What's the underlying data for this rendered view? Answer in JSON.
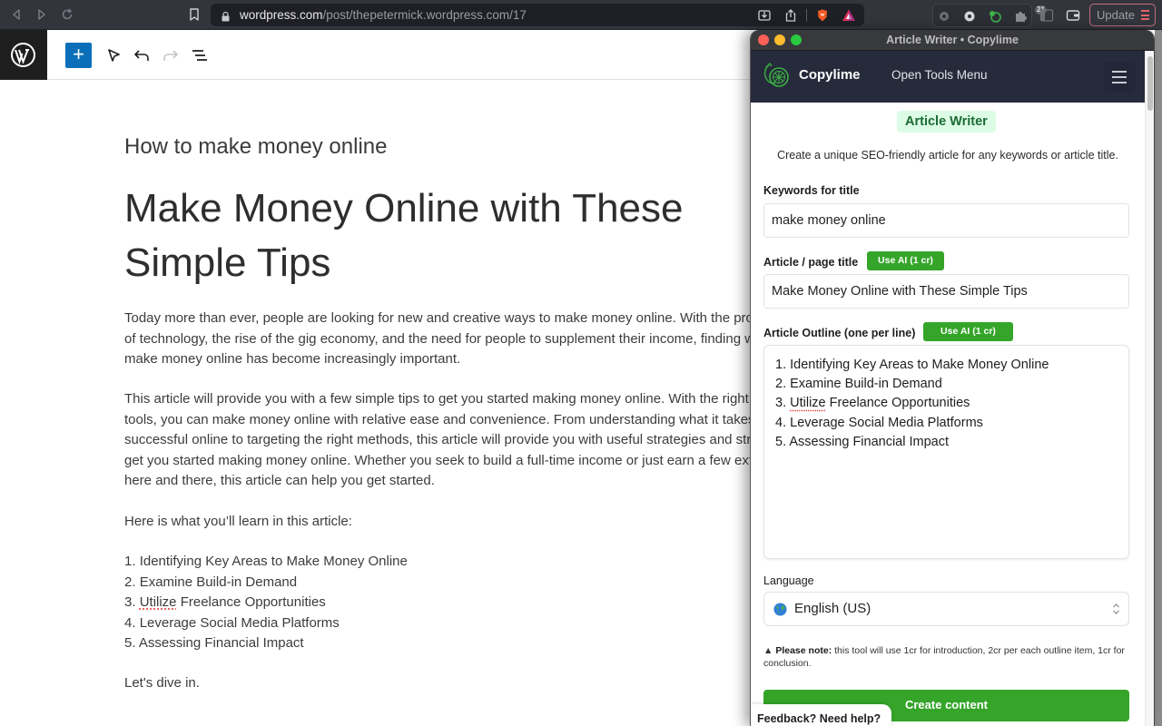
{
  "browser": {
    "url_host": "wordpress.com",
    "url_path": "/post/thepetermick.wordpress.com/17",
    "brave_shield_count": "21",
    "update_label": "Update",
    "icons": [
      "back-icon",
      "forward-icon",
      "reload-icon",
      "bookmark-icon",
      "lock-icon",
      "install-icon",
      "share-icon",
      "brave-shields-icon",
      "brave-rewards-icon",
      "extension-gear-icon",
      "extension-settings-icon",
      "copylime-extension-icon",
      "extensions-puzzle-icon",
      "sidebar-icon",
      "wallet-icon",
      "menu-icon"
    ]
  },
  "wordpress": {
    "toolbar": {
      "add_block_label": "+",
      "icons": [
        "wordpress-logo-icon",
        "add-block-icon",
        "select-tool-icon",
        "undo-icon",
        "redo-icon",
        "document-overview-icon"
      ]
    },
    "post": {
      "keyword_line": "How to make money online",
      "title": "Make Money Online with These Simple Tips",
      "paragraphs": [
        "Today more than ever, people are looking for new and creative ways to make money online. With the proliferation of technology, the rise of the gig economy, and the need for people to supplement their income, finding ways to make money online has become increasingly important.",
        "This article will provide you with a few simple tips to get you started making money online. With the right skills and tools, you can make money online with relative ease and convenience. From understanding what it takes to be successful online to targeting the right methods, this article will provide you with useful strategies and strategies to get you started making money online. Whether you seek to build a full-time income or just earn a few extra bucks here and there, this article can help you get started.",
        "Here is what you’ll learn in this article:"
      ],
      "outline": [
        {
          "num": "1. ",
          "text": "Identifying Key Areas to Make Money Online"
        },
        {
          "num": "2. ",
          "text": "Examine Build-in Demand"
        },
        {
          "num": "3. ",
          "spell": "Utilize",
          "text": " Freelance Opportunities"
        },
        {
          "num": "4. ",
          "text": "Leverage Social Media Platforms"
        },
        {
          "num": "5. ",
          "text": "Assessing Financial Impact"
        }
      ],
      "closing": "Let's dive in."
    }
  },
  "popup": {
    "window_title": "Article Writer • Copylime",
    "brand": "Copylime",
    "open_tools_menu": "Open Tools Menu",
    "tool_badge": "Article Writer",
    "subtitle": "Create a unique SEO-friendly article for any keywords or article title.",
    "keywords_label": "Keywords for title",
    "keywords_value": "make money online",
    "title_label": "Article / page title",
    "use_ai_label": "Use AI (1 cr)",
    "title_value": "Make Money Online with These Simple Tips",
    "outline_label": "Article Outline (one per line)",
    "outline_lines": [
      {
        "num": "1. ",
        "text": "Identifying Key Areas to Make Money Online"
      },
      {
        "num": "2. ",
        "text": "Examine Build-in Demand"
      },
      {
        "num": "3. ",
        "spell": "Utilize",
        "text": " Freelance Opportunities"
      },
      {
        "num": "4. ",
        "text": "Leverage Social Media Platforms"
      },
      {
        "num": "5. ",
        "text": "Assessing Financial Impact"
      }
    ],
    "language_label": "Language",
    "language_value": "English (US)",
    "note_prefix": "Please note:",
    "note_text": " this tool will use 1cr for introduction, 2cr per each outline item, 1cr for conclusion.",
    "create_button": "Create content",
    "feedback": "Feedback? Need help?",
    "colors": {
      "accent_green": "#35a52a",
      "header_bg": "#262b3b",
      "badge_bg": "#dcfce6",
      "badge_text": "#1b6b34"
    }
  }
}
